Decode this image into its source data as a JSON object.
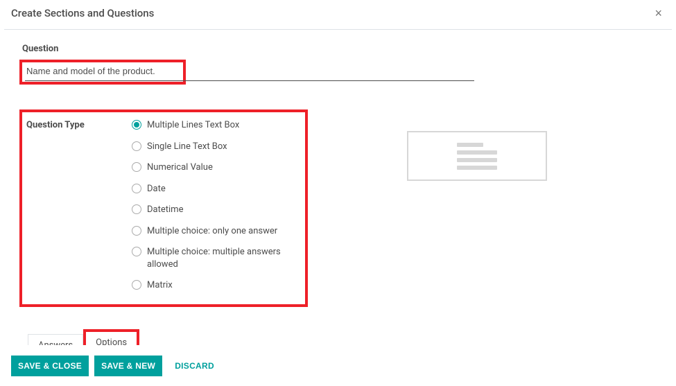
{
  "header": {
    "title": "Create Sections and Questions",
    "close": "×"
  },
  "question": {
    "label": "Question",
    "value": "Name and model of the product."
  },
  "question_type": {
    "label": "Question Type",
    "options": [
      {
        "label": "Multiple Lines Text Box",
        "selected": true
      },
      {
        "label": "Single Line Text Box",
        "selected": false
      },
      {
        "label": "Numerical Value",
        "selected": false
      },
      {
        "label": "Date",
        "selected": false
      },
      {
        "label": "Datetime",
        "selected": false
      },
      {
        "label": "Multiple choice: only one answer",
        "selected": false
      },
      {
        "label": "Multiple choice: multiple answers allowed",
        "selected": false
      },
      {
        "label": "Matrix",
        "selected": false
      }
    ]
  },
  "tabs": {
    "answers": "Answers",
    "options": "Options"
  },
  "footer": {
    "save_close": "Save & Close",
    "save_new": "Save & New",
    "discard": "Discard"
  },
  "colors": {
    "accent": "#00a09d",
    "highlight": "#ee2028"
  }
}
